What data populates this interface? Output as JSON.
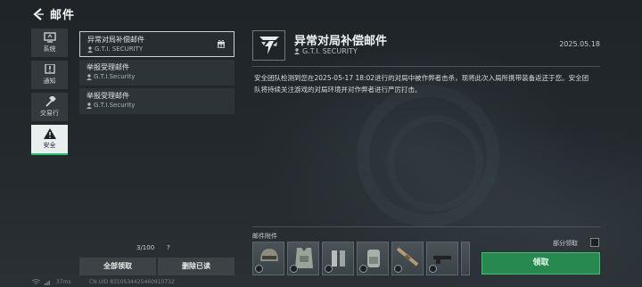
{
  "header": {
    "title": "邮件"
  },
  "sidebar": {
    "items": [
      {
        "label": "系统",
        "icon": "monitor-icon",
        "active": false
      },
      {
        "label": "通知",
        "icon": "alert-icon",
        "active": false
      },
      {
        "label": "交易行",
        "icon": "hammer-icon",
        "active": false
      },
      {
        "label": "安全",
        "icon": "warning-icon",
        "active": true
      }
    ]
  },
  "mails": [
    {
      "title": "异常对局补偿邮件",
      "sender": "G.T.I. SECURITY",
      "selected": true,
      "has_gift": true
    },
    {
      "title": "举报受理邮件",
      "sender": "G.T.I.Security",
      "selected": false,
      "has_gift": false
    },
    {
      "title": "举报受理邮件",
      "sender": "G.T.I.Security",
      "selected": false,
      "has_gift": false
    }
  ],
  "list_footer": {
    "count": "3/100",
    "help": "?"
  },
  "buttons": {
    "claim_all": "全部领取",
    "delete_read": "删除已读"
  },
  "detail": {
    "title": "异常对局补偿邮件",
    "sender": "G.T.I. SECURITY",
    "date": "2025.05.18",
    "body": "安全团队检测到您在2025-05-17 18:02进行的对局中被作弊者击杀，现将此次入局所携带装备返还于您。安全团队将持续关注游戏的对局环境并对作弊者进行严厉打击。"
  },
  "attachments": {
    "label": "邮件附件",
    "items": [
      "helmet-icon",
      "armor-vest-icon",
      "chest-rig-icon",
      "backpack-icon",
      "rifle-icon",
      "pistol-icon"
    ]
  },
  "partial_claim_label": "部分领取",
  "claim_button": "领取",
  "status": {
    "signal": "37ms",
    "uid": "CN UID 8310534425460910732"
  },
  "colors": {
    "accent_green": "#27894f",
    "active_underline": "#27c06a"
  }
}
